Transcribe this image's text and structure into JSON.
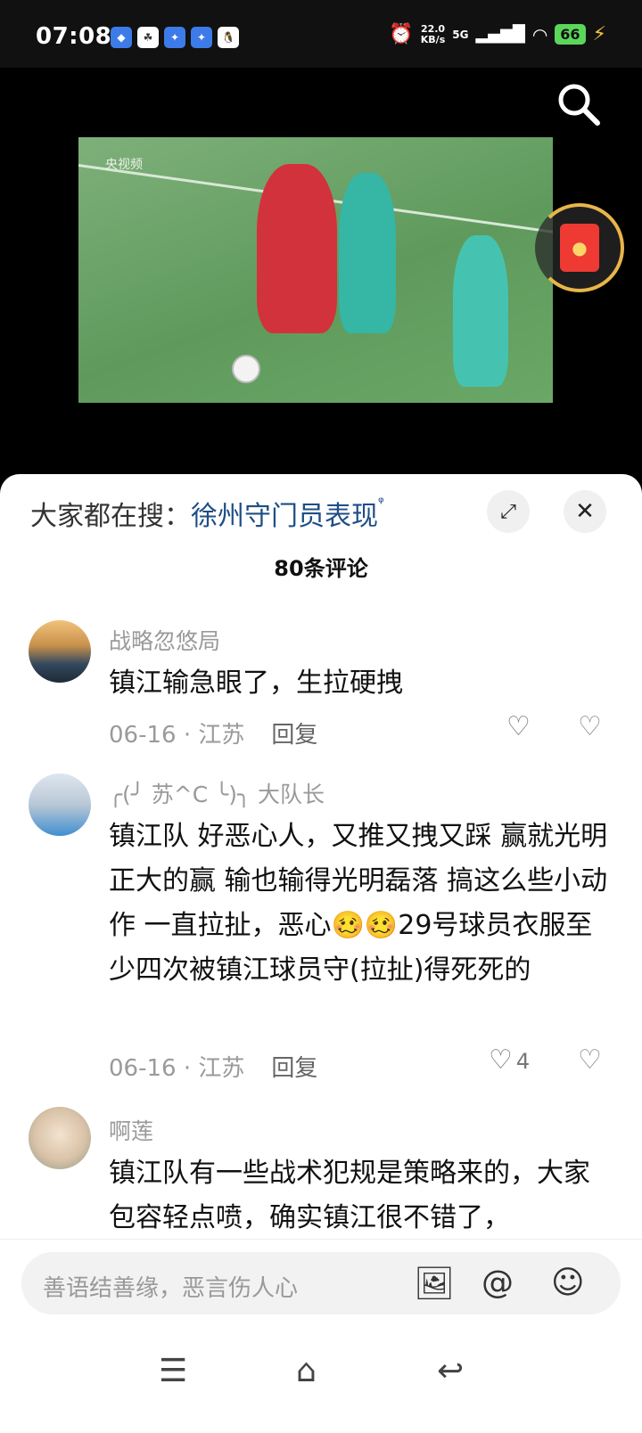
{
  "status": {
    "time": "07:08",
    "speed_top": "22.0",
    "speed_unit": "KB/s",
    "network": "5G",
    "battery": "66"
  },
  "video": {
    "watermark": "央视频"
  },
  "sheet": {
    "search_prefix": "大家都在搜：",
    "search_term": "徐州守门员表现",
    "comment_count": "80条评论"
  },
  "comments": [
    {
      "name": "战略忽悠局",
      "text": "镇江输急眼了，生拉硬拽",
      "date": "06-16 · 江苏",
      "reply": "回复",
      "likes": ""
    },
    {
      "name": "╭(╯ 苏^C ╰)╮ 大队长",
      "text": "镇江队 好恶心人，又推又拽又踩  赢就光明正大的赢  输也输得光明磊落  搞这么些小动作  一直拉扯，恶心🥴🥴29号球员衣服至少四次被镇江球员守(拉扯)得死死的",
      "date": "06-16 · 江苏",
      "reply": "回复",
      "likes": "4"
    },
    {
      "name": "啊莲",
      "text": "镇江队有一些战术犯规是策略来的，大家包容轻点喷，确实镇江很不错了，",
      "date": "",
      "reply": "",
      "likes": ""
    }
  ],
  "input": {
    "placeholder": "善语结善缘，恶言伤人心"
  }
}
